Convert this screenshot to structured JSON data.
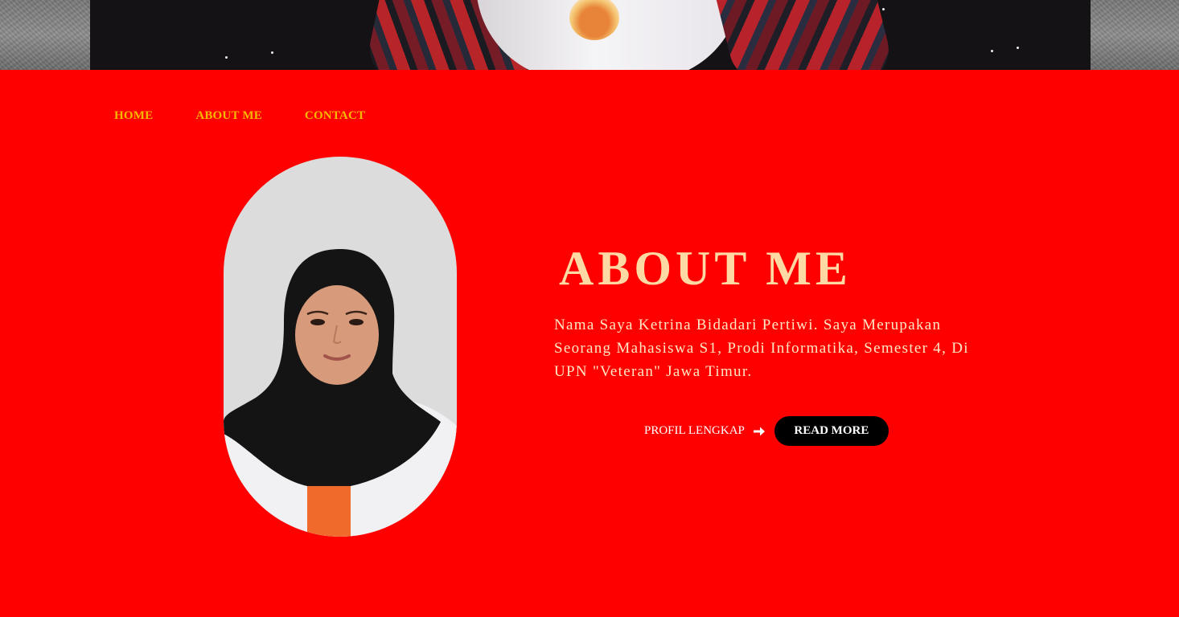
{
  "nav": {
    "items": [
      {
        "label": "HOME"
      },
      {
        "label": "ABOUT ME"
      },
      {
        "label": "CONTACT"
      }
    ]
  },
  "about": {
    "title": "ABOUT ME",
    "description": "Nama Saya Ketrina Bidadari Pertiwi. Saya Merupakan Seorang Mahasiswa S1, Prodi Informatika, Semester 4, Di UPN \"Veteran\" Jawa Timur.",
    "profile_link_label": "PROFIL LENGKAP",
    "read_more_label": "READ MORE"
  },
  "icons": {
    "profile_arrow": "arrow-right-icon"
  },
  "colors": {
    "background": "#ff0000",
    "nav_text": "#f5b800",
    "title": "#ffd9a4",
    "button_bg": "#000000"
  }
}
